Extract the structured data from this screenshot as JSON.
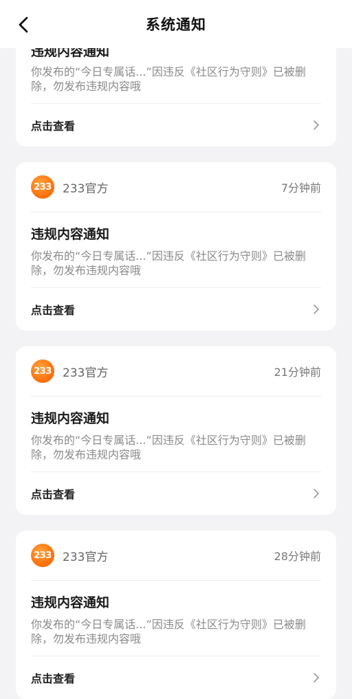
{
  "header": {
    "title": "系统通知"
  },
  "partial_card": {
    "title": "违规内容通知",
    "body": "你发布的“今日专属话...”因违反《社区行为守则》已被删除，勿发布违规内容哦",
    "action": "点击查看"
  },
  "cards": [
    {
      "avatar": "233",
      "sender": "233官方",
      "time": "7分钟前",
      "title": "违规内容通知",
      "body": "你发布的“今日专属话...”因违反《社区行为守则》已被删除，勿发布违规内容哦",
      "action": "点击查看"
    },
    {
      "avatar": "233",
      "sender": "233官方",
      "time": "21分钟前",
      "title": "违规内容通知",
      "body": "你发布的“今日专属话...”因违反《社区行为守则》已被删除，勿发布违规内容哦",
      "action": "点击查看"
    },
    {
      "avatar": "233",
      "sender": "233官方",
      "time": "28分钟前",
      "title": "违规内容通知",
      "body": "你发布的“今日专属话...”因违反《社区行为守则》已被删除，勿发布违规内容哦",
      "action": "点击查看"
    }
  ]
}
